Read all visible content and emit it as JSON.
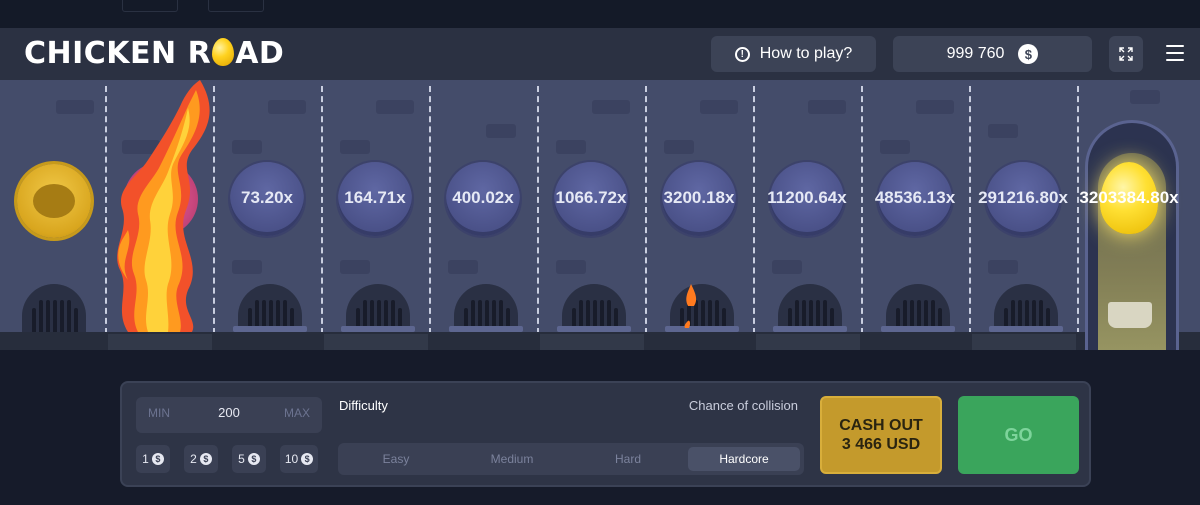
{
  "header": {
    "logo_text_left": "CHICKEN R",
    "logo_text_right": "AD",
    "how_to_play": "How to play?",
    "balance": "999 760",
    "currency_icon": "dollar-coin-icon"
  },
  "board": {
    "multipliers": [
      "73.20x",
      "164.71x",
      "400.02x",
      "1066.72x",
      "3200.18x",
      "11200.64x",
      "48536.13x",
      "291216.80x",
      "3203384.80x"
    ]
  },
  "panel": {
    "bet": {
      "min_label": "MIN",
      "value": "200",
      "max_label": "MAX"
    },
    "chips": [
      "1",
      "2",
      "5",
      "10"
    ],
    "difficulty_label": "Difficulty",
    "collision_label": "Chance of collision",
    "difficulties": [
      "Easy",
      "Medium",
      "Hard",
      "Hardcore"
    ],
    "selected_difficulty": "Hardcore",
    "cash_out_line1": "CASH OUT",
    "cash_out_line2": "3 466 USD",
    "go_label": "GO"
  },
  "colors": {
    "accent_gold": "#c49a2c",
    "go_green": "#3aa55c",
    "board": "#444c6a"
  }
}
